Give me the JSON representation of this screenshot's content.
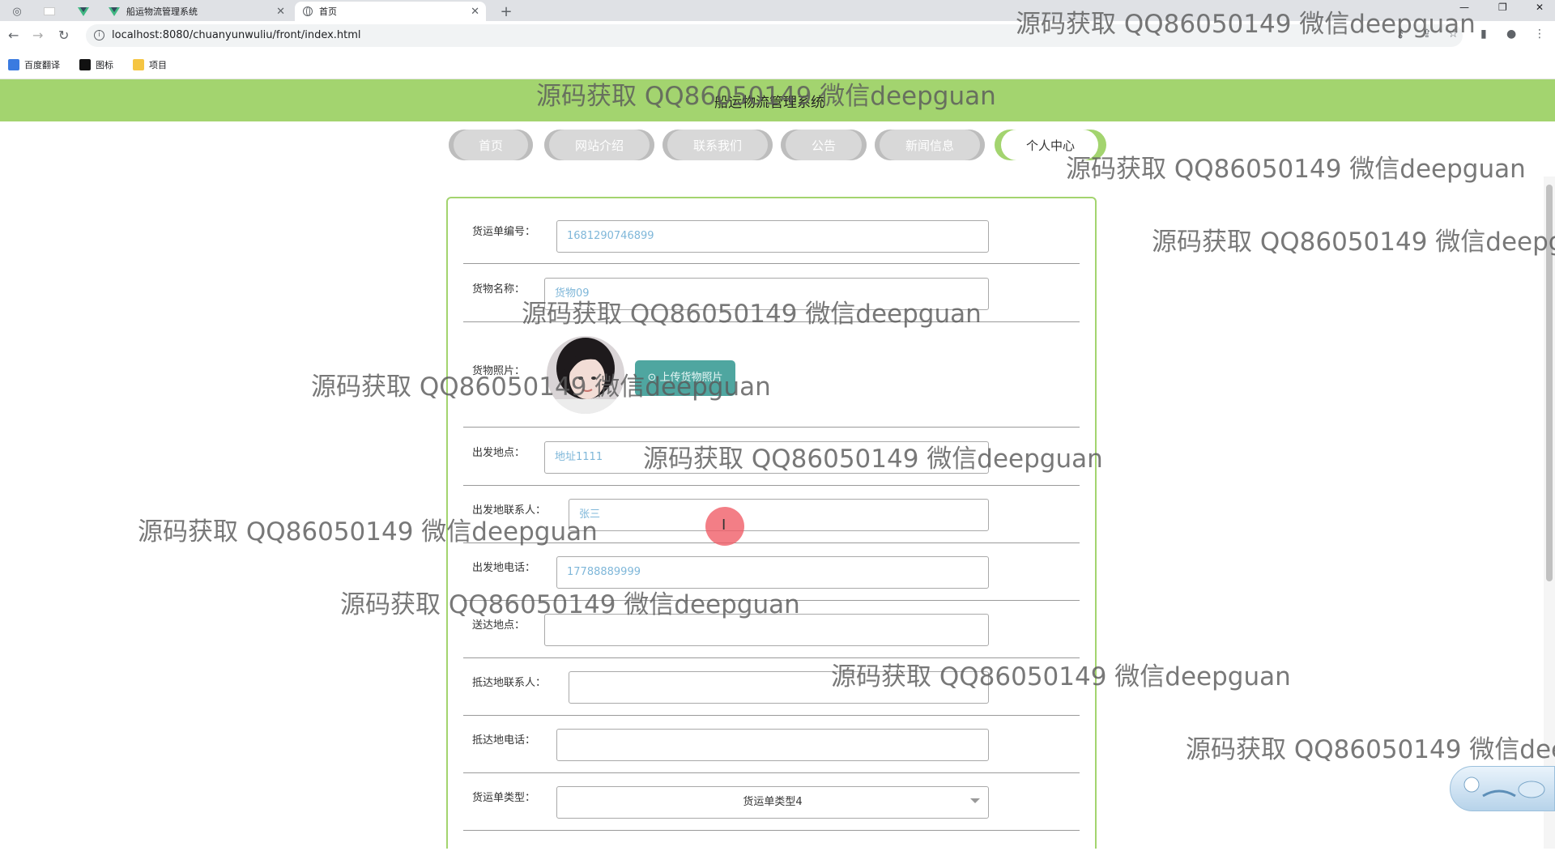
{
  "browser": {
    "tabs": [
      {
        "title": "船运物流管理系统"
      },
      {
        "title": "首页"
      }
    ],
    "new_tab": "+",
    "url": "localhost:8080/chuanyunwuliu/front/index.html",
    "bookmarks": [
      "百度翻译",
      "图标",
      "项目"
    ]
  },
  "site": {
    "title": "船运物流管理系统",
    "nav": [
      "首页",
      "网站介绍",
      "联系我们",
      "公告",
      "新闻信息",
      "个人中心"
    ]
  },
  "form": {
    "fields": [
      {
        "label": "货运单编号：",
        "value": "1681290746899"
      },
      {
        "label": "货物名称：",
        "value": "货物09"
      },
      {
        "label": "货物照片：",
        "button": "上传货物照片"
      },
      {
        "label": "出发地点：",
        "value": "地址1111"
      },
      {
        "label": "出发地联系人：",
        "value": "张三"
      },
      {
        "label": "出发地电话：",
        "value": "17788889999"
      },
      {
        "label": "送达地点：",
        "value": ""
      },
      {
        "label": "抵达地联系人：",
        "value": ""
      },
      {
        "label": "抵达地电话：",
        "value": ""
      },
      {
        "label": "货运单类型：",
        "value": "货运单类型4"
      }
    ]
  },
  "watermark": "源码获取 QQ86050149 微信deepguan",
  "colors": {
    "banner": "#a3d46f",
    "nav_inactive": "#d8d8d8",
    "upload_button": "#4fa6a0",
    "input_text": "#7fb7d9"
  }
}
